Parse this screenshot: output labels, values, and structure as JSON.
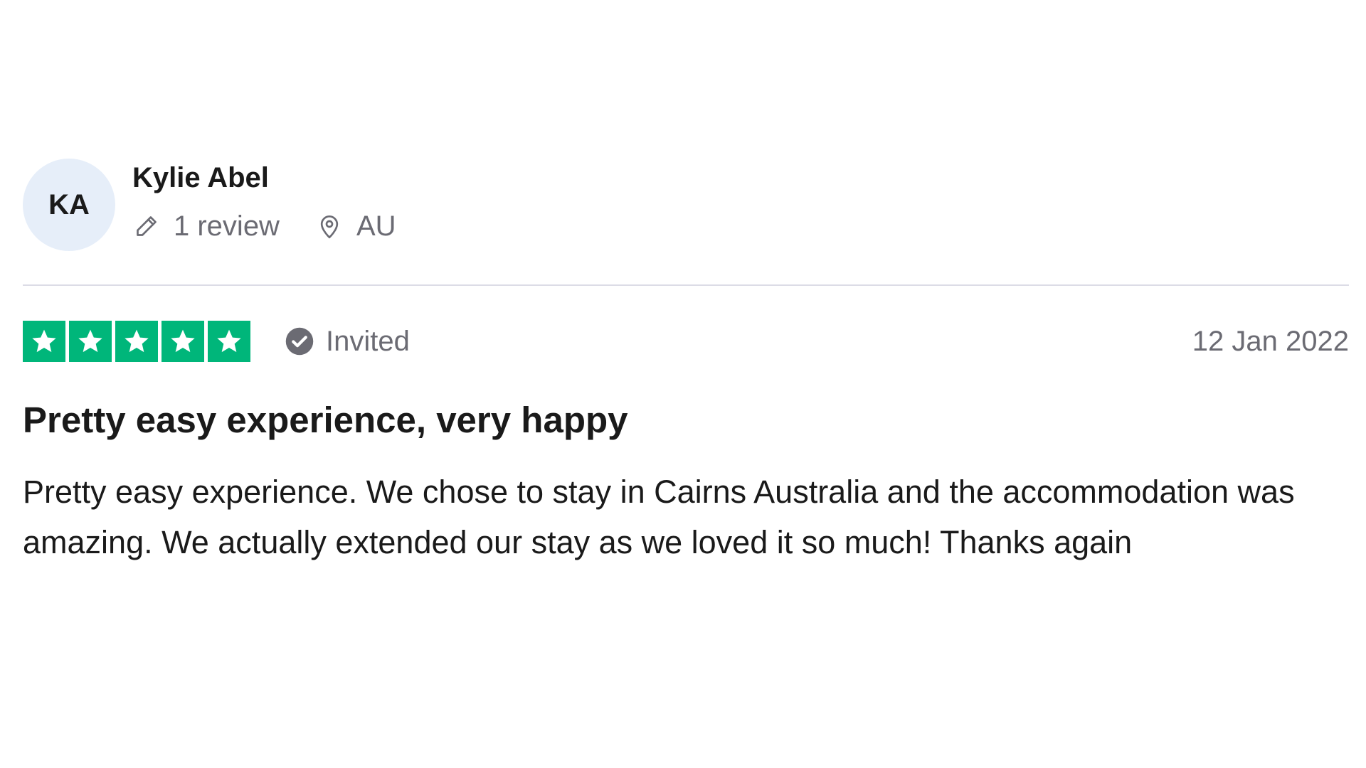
{
  "consumer": {
    "initials": "KA",
    "name": "Kylie Abel",
    "review_count": "1 review",
    "country": "AU",
    "icons": {
      "reviews": "pencil-icon",
      "location": "location-pin-icon"
    }
  },
  "review": {
    "rating": 5,
    "rating_max": 5,
    "star_color": "#00b67a",
    "status": "Invited",
    "status_icon": "check-circle-icon",
    "date": "12 Jan 2022",
    "title": "Pretty easy experience, very happy",
    "body": "Pretty easy experience. We chose to stay in Cairns Australia and the accommodation was amazing. We actually extended our stay as we loved it so much! Thanks again"
  },
  "colors": {
    "avatar_bg": "#e6eef9",
    "muted_text": "#6b6b73",
    "divider": "#dcdce6"
  }
}
